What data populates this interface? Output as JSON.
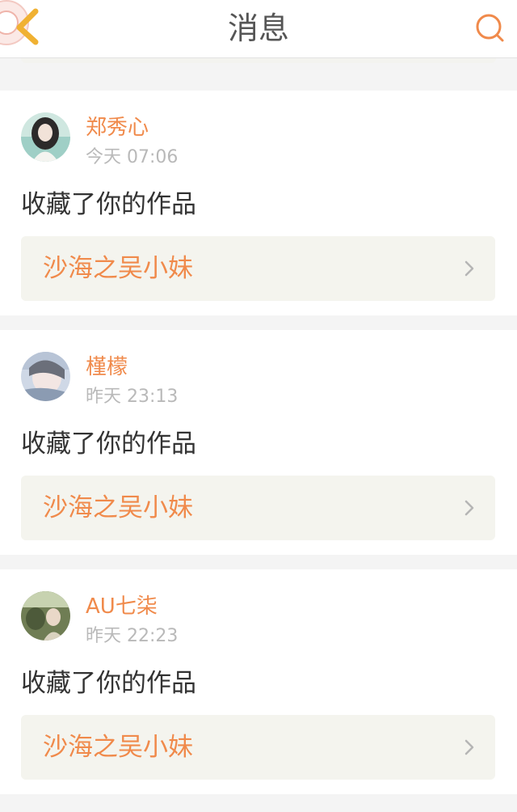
{
  "header": {
    "title": "消息"
  },
  "messages": [
    {
      "username": "郑秀心",
      "time": "今天 07:06",
      "action": "收藏了你的作品",
      "work_title": "沙海之吴小妹"
    },
    {
      "username": "槿檬",
      "time": "昨天 23:13",
      "action": "收藏了你的作品",
      "work_title": "沙海之吴小妹"
    },
    {
      "username": "AU七柒",
      "time": "昨天 22:23",
      "action": "收藏了你的作品",
      "work_title": "沙海之吴小妹"
    }
  ],
  "colors": {
    "accent": "#f08a4b",
    "text": "#333333",
    "muted": "#b9b9b9",
    "background": "#f4f4f4"
  }
}
